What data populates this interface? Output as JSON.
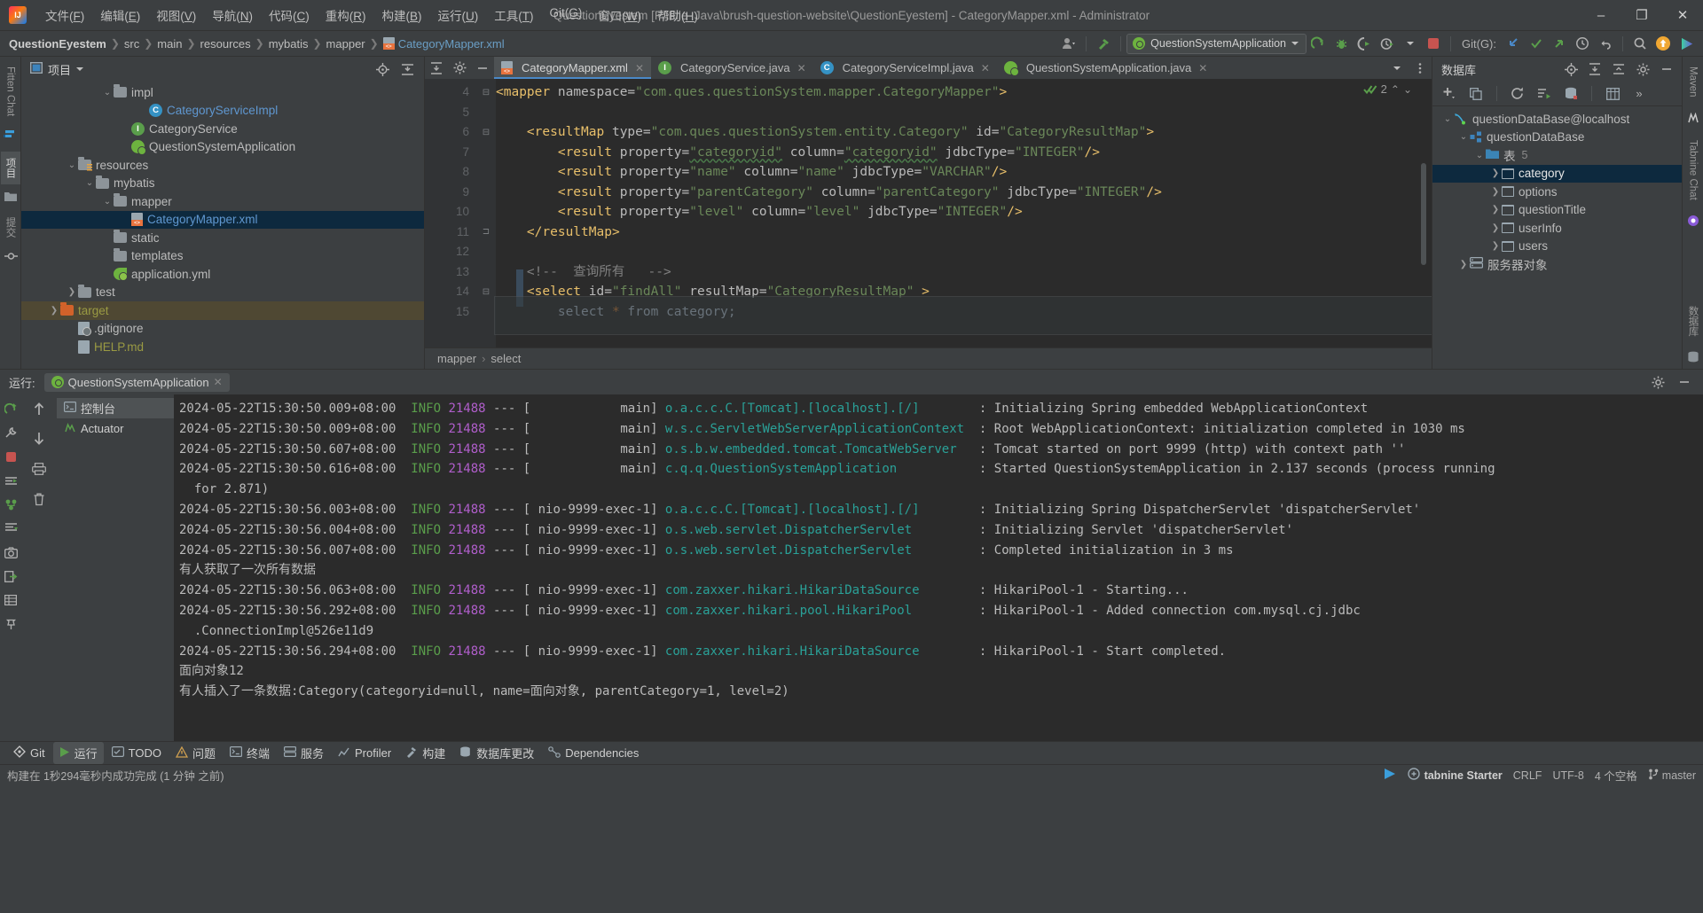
{
  "titlebar": {
    "logo": "intellij-logo",
    "menus": [
      "文件(F)",
      "编辑(E)",
      "视图(V)",
      "导航(N)",
      "代码(C)",
      "重构(R)",
      "构建(B)",
      "运行(U)",
      "工具(T)",
      "Git(G)",
      "窗口(W)",
      "帮助(H)"
    ],
    "window_title": "QuestionEyestem [F:\\File_Java\\brush-question-website\\QuestionEyestem] - CategoryMapper.xml - Administrator",
    "minimize": "–",
    "maximize": "❐",
    "close": "✕"
  },
  "navbar": {
    "crumbs": [
      "QuestionEyestem",
      "src",
      "main",
      "resources",
      "mybatis",
      "mapper"
    ],
    "file": "CategoryMapper.xml",
    "run_config": "QuestionSystemApplication",
    "git_label": "Git(G):"
  },
  "project": {
    "title": "项目",
    "tree": [
      {
        "indent": 4,
        "arrow": "v",
        "icon": "folder",
        "label": "impl",
        "color": ""
      },
      {
        "indent": 6,
        "arrow": "",
        "icon": "class",
        "label": "CategoryServiceImpl",
        "color": "blue"
      },
      {
        "indent": 5,
        "arrow": "",
        "icon": "interface",
        "label": "CategoryService",
        "color": ""
      },
      {
        "indent": 5,
        "arrow": "",
        "icon": "spring",
        "label": "QuestionSystemApplication",
        "color": ""
      },
      {
        "indent": 2,
        "arrow": "v",
        "icon": "folder-res",
        "label": "resources",
        "color": ""
      },
      {
        "indent": 3,
        "arrow": "v",
        "icon": "folder",
        "label": "mybatis",
        "color": ""
      },
      {
        "indent": 4,
        "arrow": "v",
        "icon": "folder",
        "label": "mapper",
        "color": ""
      },
      {
        "indent": 5,
        "arrow": "",
        "icon": "xml",
        "label": "CategoryMapper.xml",
        "color": "blue",
        "state": "selected"
      },
      {
        "indent": 4,
        "arrow": "",
        "icon": "folder",
        "label": "static",
        "color": ""
      },
      {
        "indent": 4,
        "arrow": "",
        "icon": "folder",
        "label": "templates",
        "color": ""
      },
      {
        "indent": 4,
        "arrow": "",
        "icon": "yml",
        "label": "application.yml",
        "color": ""
      },
      {
        "indent": 2,
        "arrow": ">",
        "icon": "folder",
        "label": "test",
        "color": ""
      },
      {
        "indent": 1,
        "arrow": ">",
        "icon": "folder-orange",
        "label": "target",
        "color": "olive",
        "state": "highlight"
      },
      {
        "indent": 2,
        "arrow": "",
        "icon": "file-git",
        "label": ".gitignore",
        "color": ""
      },
      {
        "indent": 2,
        "arrow": "",
        "icon": "file",
        "label": "HELP.md",
        "color": "olive"
      }
    ]
  },
  "left_stripe": {
    "tabs": [
      "Fitten Chat",
      "项目",
      "提交"
    ]
  },
  "right_stripe": {
    "tabs": [
      "Maven",
      "Tabnine Chat",
      "数据库"
    ]
  },
  "editor": {
    "tabs": [
      {
        "label": "CategoryMapper.xml",
        "icon": "xml-file-icon",
        "active": true
      },
      {
        "label": "CategoryService.java",
        "icon": "interface-icon",
        "active": false
      },
      {
        "label": "CategoryServiceImpl.java",
        "icon": "class-icon",
        "active": false
      },
      {
        "label": "QuestionSystemApplication.java",
        "icon": "spring-icon",
        "active": false
      }
    ],
    "inspection_count": "2",
    "line_numbers": [
      "4",
      "5",
      "6",
      "7",
      "8",
      "9",
      "10",
      "11",
      "12",
      "13",
      "14",
      "15"
    ],
    "lines": [
      [
        {
          "t": "<",
          "c": "k"
        },
        {
          "t": "mapper",
          "c": "k"
        },
        {
          "t": " namespace=",
          "c": "at"
        },
        {
          "t": "\"com.ques.questionSystem.mapper.CategoryMapper\"",
          "c": "st"
        },
        {
          "t": ">",
          "c": "k"
        }
      ],
      [],
      [
        {
          "t": "    <",
          "c": "k"
        },
        {
          "t": "resultMap",
          "c": "k"
        },
        {
          "t": " type=",
          "c": "at"
        },
        {
          "t": "\"com.ques.questionSystem.entity.Category\"",
          "c": "st"
        },
        {
          "t": " id=",
          "c": "at"
        },
        {
          "t": "\"CategoryResultMap\"",
          "c": "st"
        },
        {
          "t": ">",
          "c": "k"
        }
      ],
      [
        {
          "t": "        <",
          "c": "k"
        },
        {
          "t": "result",
          "c": "k"
        },
        {
          "t": " property=",
          "c": "at"
        },
        {
          "t": "\"categoryid\"",
          "c": "st und"
        },
        {
          "t": " column=",
          "c": "at"
        },
        {
          "t": "\"categoryid\"",
          "c": "st und"
        },
        {
          "t": " jdbcType=",
          "c": "at"
        },
        {
          "t": "\"INTEGER\"",
          "c": "st"
        },
        {
          "t": "/>",
          "c": "k"
        }
      ],
      [
        {
          "t": "        <",
          "c": "k"
        },
        {
          "t": "result",
          "c": "k"
        },
        {
          "t": " property=",
          "c": "at"
        },
        {
          "t": "\"name\"",
          "c": "st"
        },
        {
          "t": " column=",
          "c": "at"
        },
        {
          "t": "\"name\"",
          "c": "st"
        },
        {
          "t": " jdbcType=",
          "c": "at"
        },
        {
          "t": "\"VARCHAR\"",
          "c": "st"
        },
        {
          "t": "/>",
          "c": "k"
        }
      ],
      [
        {
          "t": "        <",
          "c": "k"
        },
        {
          "t": "result",
          "c": "k"
        },
        {
          "t": " property=",
          "c": "at"
        },
        {
          "t": "\"parentCategory\"",
          "c": "st"
        },
        {
          "t": " column=",
          "c": "at"
        },
        {
          "t": "\"parentCategory\"",
          "c": "st"
        },
        {
          "t": " jdbcType=",
          "c": "at"
        },
        {
          "t": "\"INTEGER\"",
          "c": "st"
        },
        {
          "t": "/>",
          "c": "k"
        }
      ],
      [
        {
          "t": "        <",
          "c": "k"
        },
        {
          "t": "result",
          "c": "k"
        },
        {
          "t": " property=",
          "c": "at"
        },
        {
          "t": "\"level\"",
          "c": "st"
        },
        {
          "t": " column=",
          "c": "at"
        },
        {
          "t": "\"level\"",
          "c": "st"
        },
        {
          "t": " jdbcType=",
          "c": "at"
        },
        {
          "t": "\"INTEGER\"",
          "c": "st"
        },
        {
          "t": "/>",
          "c": "k"
        }
      ],
      [
        {
          "t": "    </",
          "c": "k"
        },
        {
          "t": "resultMap",
          "c": "k"
        },
        {
          "t": ">",
          "c": "k"
        }
      ],
      [],
      [
        {
          "t": "    <!--  查询所有   -->",
          "c": "cm"
        }
      ],
      [
        {
          "t": "    <",
          "c": "k"
        },
        {
          "t": "select",
          "c": "k"
        },
        {
          "t": " id=",
          "c": "at"
        },
        {
          "t": "\"findAll\"",
          "c": "st"
        },
        {
          "t": " resultMap=",
          "c": "at"
        },
        {
          "t": "\"CategoryResultMap\"",
          "c": "st"
        },
        {
          "t": " >",
          "c": "k"
        }
      ],
      [
        {
          "t": "        select ",
          "c": "id"
        },
        {
          "t": "*",
          "c": "pnk"
        },
        {
          "t": " from category;",
          "c": "id"
        }
      ]
    ],
    "breadcrumb": [
      "mapper",
      "select"
    ]
  },
  "database": {
    "title": "数据库",
    "tree": [
      {
        "indent": 0,
        "arrow": "v",
        "icon": "mysql-icon",
        "label": "questionDataBase@localhost",
        "state": ""
      },
      {
        "indent": 1,
        "arrow": "v",
        "icon": "schema-icon",
        "label": "questionDataBase",
        "state": ""
      },
      {
        "indent": 2,
        "arrow": "v",
        "icon": "folder-icon",
        "label": "表",
        "badge": "5",
        "state": ""
      },
      {
        "indent": 3,
        "arrow": ">",
        "icon": "table-icon",
        "label": "category",
        "state": "selected"
      },
      {
        "indent": 3,
        "arrow": ">",
        "icon": "table-icon",
        "label": "options",
        "state": ""
      },
      {
        "indent": 3,
        "arrow": ">",
        "icon": "table-icon",
        "label": "questionTitle",
        "state": ""
      },
      {
        "indent": 3,
        "arrow": ">",
        "icon": "table-icon",
        "label": "userInfo",
        "state": ""
      },
      {
        "indent": 3,
        "arrow": ">",
        "icon": "table-icon",
        "label": "users",
        "state": ""
      },
      {
        "indent": 1,
        "arrow": ">",
        "icon": "server-icon",
        "label": "服务器对象",
        "state": ""
      }
    ]
  },
  "run_panel": {
    "label": "运行:",
    "config_tab": "QuestionSystemApplication",
    "tabs": [
      {
        "label": "控制台",
        "icon": "console-icon",
        "selected": true
      },
      {
        "label": "Actuator",
        "icon": "actuator-icon",
        "selected": false
      }
    ],
    "console": [
      {
        "type": "log",
        "ts": "2024-05-22T15:30:50.009+08:00",
        "lv": "INFO",
        "pid": "21488",
        "thread": "main",
        "cls": "o.a.c.c.C.[Tomcat].[localhost].[/]",
        "msg": "Initializing Spring embedded WebApplicationContext"
      },
      {
        "type": "log",
        "ts": "2024-05-22T15:30:50.009+08:00",
        "lv": "INFO",
        "pid": "21488",
        "thread": "main",
        "cls": "w.s.c.ServletWebServerApplicationContext",
        "msg": "Root WebApplicationContext: initialization completed in 1030 ms"
      },
      {
        "type": "log",
        "ts": "2024-05-22T15:30:50.607+08:00",
        "lv": "INFO",
        "pid": "21488",
        "thread": "main",
        "cls": "o.s.b.w.embedded.tomcat.TomcatWebServer",
        "msg": "Tomcat started on port 9999 (http) with context path ''"
      },
      {
        "type": "log",
        "ts": "2024-05-22T15:30:50.616+08:00",
        "lv": "INFO",
        "pid": "21488",
        "thread": "main",
        "cls": "c.q.q.QuestionSystemApplication",
        "msg": "Started QuestionSystemApplication in 2.137 seconds (process running"
      },
      {
        "type": "cont",
        "text": "  for 2.871)"
      },
      {
        "type": "log",
        "ts": "2024-05-22T15:30:56.003+08:00",
        "lv": "INFO",
        "pid": "21488",
        "thread": "nio-9999-exec-1",
        "cls": "o.a.c.c.C.[Tomcat].[localhost].[/]",
        "msg": "Initializing Spring DispatcherServlet 'dispatcherServlet'"
      },
      {
        "type": "log",
        "ts": "2024-05-22T15:30:56.004+08:00",
        "lv": "INFO",
        "pid": "21488",
        "thread": "nio-9999-exec-1",
        "cls": "o.s.web.servlet.DispatcherServlet",
        "msg": "Initializing Servlet 'dispatcherServlet'"
      },
      {
        "type": "log",
        "ts": "2024-05-22T15:30:56.007+08:00",
        "lv": "INFO",
        "pid": "21488",
        "thread": "nio-9999-exec-1",
        "cls": "o.s.web.servlet.DispatcherServlet",
        "msg": "Completed initialization in 3 ms"
      },
      {
        "type": "plain",
        "text": "有人获取了一次所有数据"
      },
      {
        "type": "log",
        "ts": "2024-05-22T15:30:56.063+08:00",
        "lv": "INFO",
        "pid": "21488",
        "thread": "nio-9999-exec-1",
        "cls": "com.zaxxer.hikari.HikariDataSource",
        "msg": "HikariPool-1 - Starting..."
      },
      {
        "type": "log",
        "ts": "2024-05-22T15:30:56.292+08:00",
        "lv": "INFO",
        "pid": "21488",
        "thread": "nio-9999-exec-1",
        "cls": "com.zaxxer.hikari.pool.HikariPool",
        "msg": "HikariPool-1 - Added connection com.mysql.cj.jdbc"
      },
      {
        "type": "cont",
        "text": "  .ConnectionImpl@526e11d9"
      },
      {
        "type": "log",
        "ts": "2024-05-22T15:30:56.294+08:00",
        "lv": "INFO",
        "pid": "21488",
        "thread": "nio-9999-exec-1",
        "cls": "com.zaxxer.hikari.HikariDataSource",
        "msg": "HikariPool-1 - Start completed."
      },
      {
        "type": "plain",
        "text": "面向对象12"
      },
      {
        "type": "plain",
        "text": "有人插入了一条数据:Category(categoryid=null, name=面向对象, parentCategory=1, level=2)"
      }
    ]
  },
  "toolstrip": [
    {
      "label": "Git",
      "icon": "git-icon",
      "selected": false
    },
    {
      "label": "运行",
      "icon": "run-icon",
      "selected": true
    },
    {
      "label": "TODO",
      "icon": "todo-icon",
      "selected": false
    },
    {
      "label": "问题",
      "icon": "problems-icon",
      "selected": false
    },
    {
      "label": "终端",
      "icon": "terminal-icon",
      "selected": false
    },
    {
      "label": "服务",
      "icon": "services-icon",
      "selected": false
    },
    {
      "label": "Profiler",
      "icon": "profiler-icon",
      "selected": false
    },
    {
      "label": "构建",
      "icon": "build-icon",
      "selected": false
    },
    {
      "label": "数据库更改",
      "icon": "db-changes-icon",
      "selected": false
    },
    {
      "label": "Dependencies",
      "icon": "dependencies-icon",
      "selected": false
    }
  ],
  "statusbar": {
    "message": "构建在 1秒294毫秒内成功完成 (1 分钟 之前)",
    "plugin": "tabnine Starter",
    "line_sep": "CRLF",
    "encoding": "UTF-8",
    "indent": "4 个空格",
    "branch": "master"
  },
  "colors": {
    "accent_blue": "#4a88c7",
    "selection": "#0d293e",
    "highlight": "#4f4833",
    "string_green": "#6a8759",
    "tag_gold": "#e8bf6a",
    "info_green": "#5a9e4b",
    "pid_purple": "#b05ecb",
    "class_teal": "#2aa198"
  }
}
